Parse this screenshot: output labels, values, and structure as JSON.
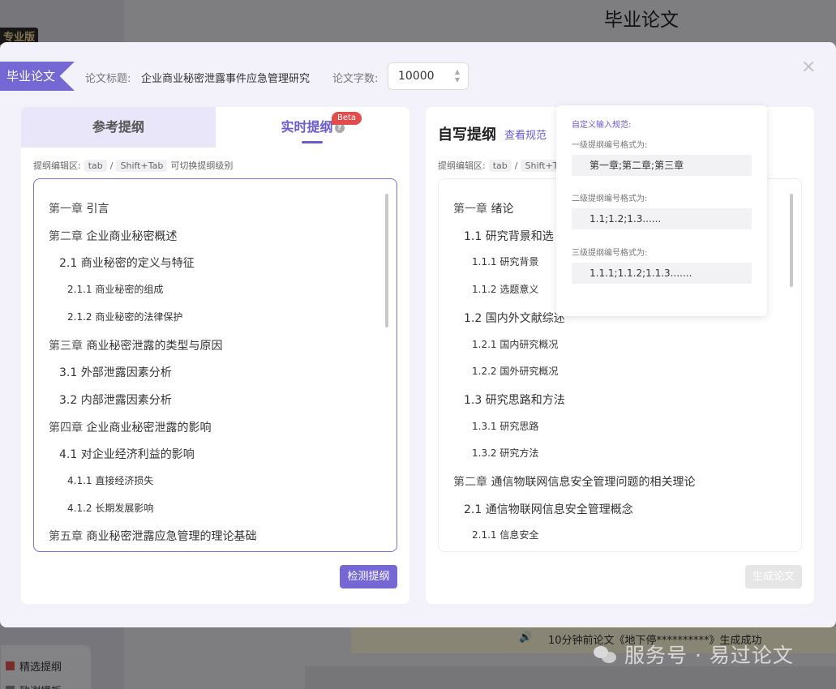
{
  "background": {
    "page_title": "毕业论文",
    "badge": "专业版",
    "menu": [
      "精选提纲",
      "致谢模板"
    ],
    "notice": "10分钟前论文《地下停**********》生成成功",
    "watermark": "服务号 · 易过论文"
  },
  "modal": {
    "tag": "毕业论文",
    "title_label": "论文标题:",
    "title_value": "企业商业秘密泄露事件应急管理研究",
    "count_label": "论文字数:",
    "count_value": "10000",
    "close": "×"
  },
  "left_panel": {
    "tab_ref": "参考提纲",
    "tab_live": "实时提纲",
    "tab_live_help": "?",
    "beta": "Beta",
    "hint_prefix": "提纲编辑区:",
    "hint_key1": "tab",
    "hint_sep": "/",
    "hint_key2": "Shift+Tab",
    "hint_suffix": "可切换提纲级别",
    "outline": [
      {
        "level": 1,
        "num": "第一章",
        "text": "引言"
      },
      {
        "level": 1,
        "num": "第二章",
        "text": "企业商业秘密概述"
      },
      {
        "level": 2,
        "num": "2.1",
        "text": "商业秘密的定义与特征"
      },
      {
        "level": 3,
        "num": "2.1.1",
        "text": "商业秘密的组成"
      },
      {
        "level": 3,
        "num": "2.1.2",
        "text": "商业秘密的法律保护"
      },
      {
        "level": 1,
        "num": "第三章",
        "text": "商业秘密泄露的类型与原因"
      },
      {
        "level": 2,
        "num": "3.1",
        "text": "外部泄露因素分析"
      },
      {
        "level": 2,
        "num": "3.2",
        "text": "内部泄露因素分析"
      },
      {
        "level": 1,
        "num": "第四章",
        "text": "企业商业秘密泄露的影响"
      },
      {
        "level": 2,
        "num": "4.1",
        "text": "对企业经济利益的影响"
      },
      {
        "level": 3,
        "num": "4.1.1",
        "text": "直接经济损失"
      },
      {
        "level": 3,
        "num": "4.1.2",
        "text": "长期发展影响"
      },
      {
        "level": 1,
        "num": "第五章",
        "text": "商业秘密泄露应急管理的理论基础"
      }
    ],
    "check_button": "检测提纲"
  },
  "right_panel": {
    "title": "自写提纲",
    "spec_link": "查看规范",
    "hint_prefix": "提纲编辑区:",
    "hint_key1": "tab",
    "hint_sep": "/",
    "hint_key2": "Shift+Ta",
    "outline": [
      {
        "level": 1,
        "num": "第一章",
        "text": "绪论"
      },
      {
        "level": 2,
        "num": "1.1",
        "text": "研究背景和选"
      },
      {
        "level": 3,
        "num": "1.1.1",
        "text": "研究背景"
      },
      {
        "level": 3,
        "num": "1.1.2",
        "text": "选题意义"
      },
      {
        "level": 2,
        "num": "1.2",
        "text": "国内外文献综述"
      },
      {
        "level": 3,
        "num": "1.2.1",
        "text": "国内研究概况"
      },
      {
        "level": 3,
        "num": "1.2.2",
        "text": "国外研究概况"
      },
      {
        "level": 2,
        "num": "1.3",
        "text": "研究思路和方法"
      },
      {
        "level": 3,
        "num": "1.3.1",
        "text": "研究思路"
      },
      {
        "level": 3,
        "num": "1.3.2",
        "text": "研究方法"
      },
      {
        "level": 1,
        "num": "第二章",
        "text": "通信物联网信息安全管理问题的相关理论"
      },
      {
        "level": 2,
        "num": "2.1",
        "text": "通信物联网信息安全管理概念"
      },
      {
        "level": 3,
        "num": "2.1.1",
        "text": "信息安全"
      }
    ],
    "generate_button": "生成论文"
  },
  "popover": {
    "title": "自定义输入规范:",
    "label1": "一级提纲编号格式为:",
    "value1": "第一章;第二章;第三章",
    "label2": "二级提纲编号格式为:",
    "value2": "1.1;1.2;1.3......",
    "label3": "三级提纲编号格式为:",
    "value3": "1.1.1;1.1.2;1.1.3......."
  }
}
